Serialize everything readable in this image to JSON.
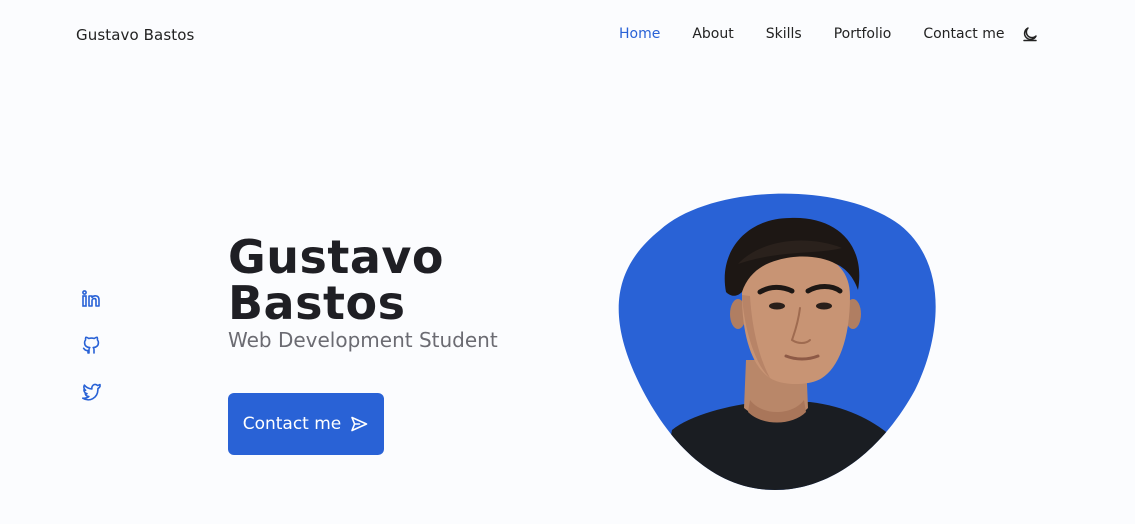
{
  "header": {
    "logo": "Gustavo Bastos",
    "nav": [
      {
        "label": "Home",
        "active": true
      },
      {
        "label": "About"
      },
      {
        "label": "Skills"
      },
      {
        "label": "Portfolio"
      },
      {
        "label": "Contact me"
      }
    ],
    "theme_toggle_icon": "moon-icon"
  },
  "socials": [
    {
      "icon": "linkedin-icon"
    },
    {
      "icon": "github-icon"
    },
    {
      "icon": "twitter-icon"
    }
  ],
  "hero": {
    "title_line1": "Gustavo",
    "title_line2": "Bastos",
    "subtitle": "Web Development Student",
    "cta_label": "Contact me",
    "cta_icon": "send-icon"
  },
  "colors": {
    "accent": "#2962d6",
    "background": "#fbfcfe",
    "text": "#1f1f24",
    "muted": "#6b6b72"
  }
}
